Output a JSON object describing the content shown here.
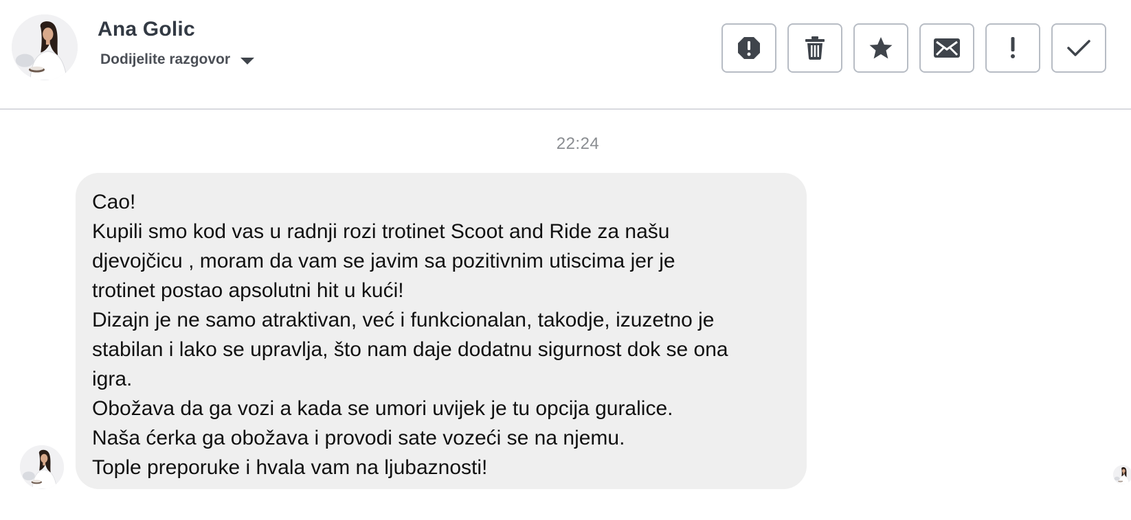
{
  "header": {
    "contact_name": "Ana Golic",
    "assign_label": "Dodijelite razgovor",
    "actions": [
      {
        "name": "spam-button",
        "icon": "octagon-exclamation-icon"
      },
      {
        "name": "delete-button",
        "icon": "trash-icon"
      },
      {
        "name": "star-button",
        "icon": "star-icon"
      },
      {
        "name": "mark-unread-button",
        "icon": "envelope-icon"
      },
      {
        "name": "important-button",
        "icon": "exclamation-icon"
      },
      {
        "name": "done-button",
        "icon": "checkmark-icon"
      }
    ]
  },
  "conversation": {
    "timestamp": "22:24",
    "message_lines": [
      "Cao!",
      "Kupili smo kod vas u radnji rozi trotinet Scoot and Ride za našu",
      "djevojčicu , moram da vam se javim sa pozitivnim utiscima jer je",
      "trotinet postao apsolutni hit u kući!",
      "Dizajn je ne samo atraktivan, već i funkcionalan, takodje, izuzetno je",
      "stabilan i lako se upravlja, što nam daje dodatnu sigurnost dok se ona",
      "igra.",
      "Obožava da ga vozi a kada se umori uvijek je tu opcija guralice.",
      "Naša ćerka ga obožava i provodi sate vozeći se na njemu.",
      "Tople preporuke i hvala vam na ljubaznosti!"
    ]
  },
  "colors": {
    "bubble_bg": "#efefef",
    "border": "#b7bcc4",
    "icon": "#3f444b",
    "timestamp": "#8a8d91"
  }
}
